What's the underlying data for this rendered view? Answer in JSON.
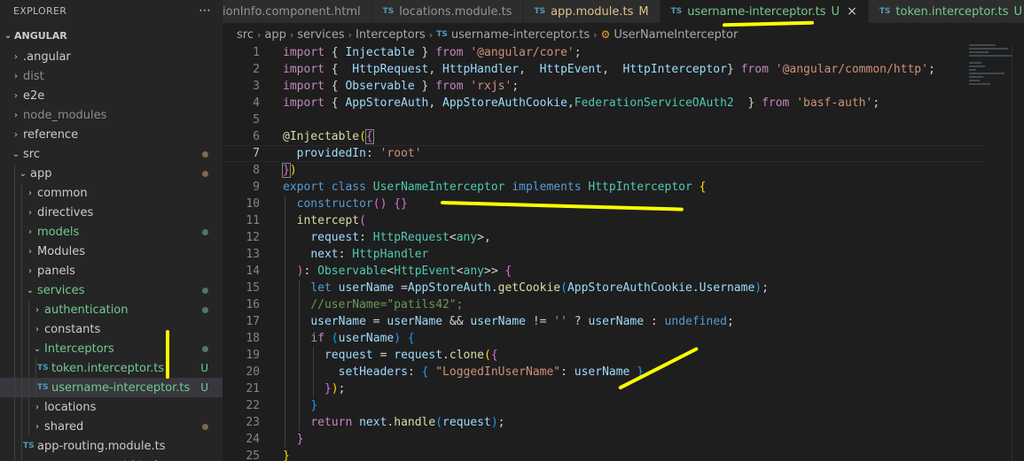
{
  "sidebar": {
    "title": "EXPLORER",
    "more_icon": "ellipsis-icon",
    "root": "ANGULAR",
    "items": [
      {
        "label": ".angular",
        "depth": 0,
        "kind": "folder",
        "expanded": false,
        "color": "#cccccc",
        "status": ""
      },
      {
        "label": "dist",
        "depth": 0,
        "kind": "folder",
        "expanded": false,
        "color": "#8c8c8c",
        "status": ""
      },
      {
        "label": "e2e",
        "depth": 0,
        "kind": "folder",
        "expanded": false,
        "color": "#cccccc",
        "status": ""
      },
      {
        "label": "node_modules",
        "depth": 0,
        "kind": "folder",
        "expanded": false,
        "color": "#8c8c8c",
        "status": ""
      },
      {
        "label": "reference",
        "depth": 0,
        "kind": "folder",
        "expanded": false,
        "color": "#cccccc",
        "status": ""
      },
      {
        "label": "src",
        "depth": 0,
        "kind": "folder",
        "expanded": true,
        "color": "#cccccc",
        "status": "dot-brown"
      },
      {
        "label": "app",
        "depth": 1,
        "kind": "folder",
        "expanded": true,
        "color": "#cccccc",
        "status": "dot-brown"
      },
      {
        "label": "common",
        "depth": 2,
        "kind": "folder",
        "expanded": false,
        "color": "#cccccc",
        "status": ""
      },
      {
        "label": "directives",
        "depth": 2,
        "kind": "folder",
        "expanded": false,
        "color": "#cccccc",
        "status": ""
      },
      {
        "label": "models",
        "depth": 2,
        "kind": "folder",
        "expanded": false,
        "color": "#73c991",
        "status": "dot-green"
      },
      {
        "label": "Modules",
        "depth": 2,
        "kind": "folder",
        "expanded": false,
        "color": "#cccccc",
        "status": ""
      },
      {
        "label": "panels",
        "depth": 2,
        "kind": "folder",
        "expanded": false,
        "color": "#cccccc",
        "status": ""
      },
      {
        "label": "services",
        "depth": 2,
        "kind": "folder",
        "expanded": true,
        "color": "#73c991",
        "status": "dot-green"
      },
      {
        "label": "authentication",
        "depth": 3,
        "kind": "folder",
        "expanded": false,
        "color": "#73c991",
        "status": "dot-green"
      },
      {
        "label": "constants",
        "depth": 3,
        "kind": "folder",
        "expanded": false,
        "color": "#cccccc",
        "status": ""
      },
      {
        "label": "Interceptors",
        "depth": 3,
        "kind": "folder",
        "expanded": true,
        "color": "#73c991",
        "status": "dot-green"
      },
      {
        "label": "token.interceptor.ts",
        "depth": 4,
        "kind": "ts",
        "color": "#73c991",
        "status": "U"
      },
      {
        "label": "username-interceptor.ts",
        "depth": 4,
        "kind": "ts",
        "color": "#73c991",
        "status": "U",
        "selected": true
      },
      {
        "label": "locations",
        "depth": 3,
        "kind": "folder",
        "expanded": false,
        "color": "#cccccc",
        "status": ""
      },
      {
        "label": "shared",
        "depth": 3,
        "kind": "folder",
        "expanded": false,
        "color": "#cccccc",
        "status": "dot-brown"
      },
      {
        "label": "app-routing.module.ts",
        "depth": 2,
        "kind": "ts",
        "color": "#cccccc",
        "status": ""
      },
      {
        "label": "app.component.html",
        "depth": 2,
        "kind": "html",
        "color": "#e2c08d",
        "status": "M"
      }
    ]
  },
  "tabs": [
    {
      "icon": "",
      "label": "ionInfo.component.html",
      "status": "",
      "color": "#969696",
      "active": false
    },
    {
      "icon": "TS",
      "label": "locations.module.ts",
      "status": "",
      "color": "#969696",
      "active": false
    },
    {
      "icon": "TS",
      "label": "app.module.ts",
      "status": "M",
      "color": "#e2c08d",
      "active": false
    },
    {
      "icon": "TS",
      "label": "username-interceptor.ts",
      "status": "U",
      "color": "#73c991",
      "active": true,
      "close": "×"
    },
    {
      "icon": "TS",
      "label": "token.interceptor.ts",
      "status": "U",
      "color": "#73c991",
      "active": false
    }
  ],
  "breadcrumb": [
    "src",
    "app",
    "services",
    "Interceptors",
    "username-interceptor.ts",
    "UserNameInterceptor"
  ],
  "editor": {
    "current_line": 7,
    "lines": [
      [
        [
          "k",
          "import "
        ],
        [
          "p",
          "{ "
        ],
        [
          "v",
          "Injectable"
        ],
        [
          "p",
          " } "
        ],
        [
          "k",
          "from "
        ],
        [
          "s",
          "'@angular/core'"
        ],
        [
          "p",
          ";"
        ]
      ],
      [
        [
          "k",
          "import "
        ],
        [
          "p",
          "{  "
        ],
        [
          "v",
          "HttpRequest"
        ],
        [
          "p",
          ", "
        ],
        [
          "v",
          "HttpHandler"
        ],
        [
          "p",
          ",  "
        ],
        [
          "v",
          "HttpEvent"
        ],
        [
          "p",
          ",  "
        ],
        [
          "v",
          "HttpInterceptor"
        ],
        [
          "p",
          "} "
        ],
        [
          "k",
          "from "
        ],
        [
          "s",
          "'@angular/common/http'"
        ],
        [
          "p",
          ";"
        ]
      ],
      [
        [
          "k",
          "import "
        ],
        [
          "p",
          "{ "
        ],
        [
          "v",
          "Observable"
        ],
        [
          "p",
          " } "
        ],
        [
          "k",
          "from "
        ],
        [
          "s",
          "'rxjs'"
        ],
        [
          "p",
          ";"
        ]
      ],
      [
        [
          "k",
          "import "
        ],
        [
          "p",
          "{ "
        ],
        [
          "v",
          "AppStoreAuth"
        ],
        [
          "p",
          ", "
        ],
        [
          "v",
          "AppStoreAuthCookie"
        ],
        [
          "p",
          ","
        ],
        [
          "t",
          "FederationServiceOAuth2"
        ],
        [
          "p",
          "  } "
        ],
        [
          "k",
          "from "
        ],
        [
          "s",
          "'basf-auth'"
        ],
        [
          "p",
          ";"
        ]
      ],
      [],
      [
        [
          "f",
          "@Injectable"
        ],
        [
          "b1",
          "("
        ],
        [
          "b2bm",
          "{"
        ]
      ],
      [
        [
          "p",
          "  "
        ],
        [
          "v",
          "providedIn"
        ],
        [
          "p",
          ": "
        ],
        [
          "s",
          "'root'"
        ]
      ],
      [
        [
          "b2bm",
          "}"
        ],
        [
          "b1",
          ")"
        ]
      ],
      [
        [
          "kb",
          "export "
        ],
        [
          "kb",
          "class "
        ],
        [
          "t",
          "UserNameInterceptor "
        ],
        [
          "kb",
          "implements "
        ],
        [
          "t",
          "HttpInterceptor "
        ],
        [
          "b1",
          "{"
        ]
      ],
      [
        [
          "p",
          "  "
        ],
        [
          "kb",
          "constructor"
        ],
        [
          "b2",
          "() "
        ],
        [
          "b2",
          "{}"
        ]
      ],
      [
        [
          "p",
          "  "
        ],
        [
          "f",
          "intercept"
        ],
        [
          "b2",
          "("
        ]
      ],
      [
        [
          "p",
          "    "
        ],
        [
          "v",
          "request"
        ],
        [
          "p",
          ": "
        ],
        [
          "t",
          "HttpRequest"
        ],
        [
          "p",
          "<"
        ],
        [
          "t",
          "any"
        ],
        [
          "p",
          ">,"
        ]
      ],
      [
        [
          "p",
          "    "
        ],
        [
          "v",
          "next"
        ],
        [
          "p",
          ": "
        ],
        [
          "t",
          "HttpHandler"
        ]
      ],
      [
        [
          "p",
          "  "
        ],
        [
          "b2",
          ")"
        ],
        [
          "p",
          ": "
        ],
        [
          "t",
          "Observable"
        ],
        [
          "p",
          "<"
        ],
        [
          "t",
          "HttpEvent"
        ],
        [
          "p",
          "<"
        ],
        [
          "t",
          "any"
        ],
        [
          "p",
          ">> "
        ],
        [
          "b2",
          "{"
        ]
      ],
      [
        [
          "p",
          "    "
        ],
        [
          "kb",
          "let "
        ],
        [
          "v",
          "userName "
        ],
        [
          "p",
          "="
        ],
        [
          "v",
          "AppStoreAuth"
        ],
        [
          "p",
          "."
        ],
        [
          "f",
          "getCookie"
        ],
        [
          "b3",
          "("
        ],
        [
          "v",
          "AppStoreAuthCookie"
        ],
        [
          "p",
          "."
        ],
        [
          "v",
          "Username"
        ],
        [
          "b3",
          ")"
        ],
        [
          "p",
          ";"
        ]
      ],
      [
        [
          "p",
          "    "
        ],
        [
          "c",
          "//userName=\"patils42\";"
        ]
      ],
      [
        [
          "p",
          "    "
        ],
        [
          "v",
          "userName "
        ],
        [
          "p",
          "= "
        ],
        [
          "v",
          "userName "
        ],
        [
          "p",
          "&& "
        ],
        [
          "v",
          "userName "
        ],
        [
          "p",
          "!= "
        ],
        [
          "s",
          "'' "
        ],
        [
          "p",
          "? "
        ],
        [
          "v",
          "userName "
        ],
        [
          "p",
          ": "
        ],
        [
          "kb",
          "undefined"
        ],
        [
          "p",
          ";"
        ]
      ],
      [
        [
          "p",
          "    "
        ],
        [
          "k",
          "if "
        ],
        [
          "b3",
          "("
        ],
        [
          "v",
          "userName"
        ],
        [
          "b3",
          ") "
        ],
        [
          "b3",
          "{"
        ]
      ],
      [
        [
          "p",
          "      "
        ],
        [
          "v",
          "request "
        ],
        [
          "p",
          "= "
        ],
        [
          "v",
          "request"
        ],
        [
          "p",
          "."
        ],
        [
          "f",
          "clone"
        ],
        [
          "b1",
          "("
        ],
        [
          "b2",
          "{"
        ]
      ],
      [
        [
          "p",
          "        "
        ],
        [
          "v",
          "setHeaders"
        ],
        [
          "p",
          ": "
        ],
        [
          "b3",
          "{ "
        ],
        [
          "s",
          "\"LoggedInUserName\""
        ],
        [
          "p",
          ": "
        ],
        [
          "v",
          "userName "
        ],
        [
          "b3",
          "}"
        ]
      ],
      [
        [
          "p",
          "      "
        ],
        [
          "b2",
          "}"
        ],
        [
          "b1",
          ")"
        ],
        [
          "p",
          ";"
        ]
      ],
      [
        [
          "p",
          "    "
        ],
        [
          "b3",
          "}"
        ]
      ],
      [
        [
          "p",
          "    "
        ],
        [
          "k",
          "return "
        ],
        [
          "v",
          "next"
        ],
        [
          "p",
          "."
        ],
        [
          "f",
          "handle"
        ],
        [
          "b3",
          "("
        ],
        [
          "v",
          "request"
        ],
        [
          "b3",
          ")"
        ],
        [
          "p",
          ";"
        ]
      ],
      [
        [
          "p",
          "  "
        ],
        [
          "b2",
          "}"
        ]
      ],
      [
        [
          "b1",
          "}"
        ]
      ]
    ]
  },
  "colors": {
    "background": "#1e1e1e",
    "sidebar": "#252526",
    "annotation_yellow": "#ffff00"
  }
}
